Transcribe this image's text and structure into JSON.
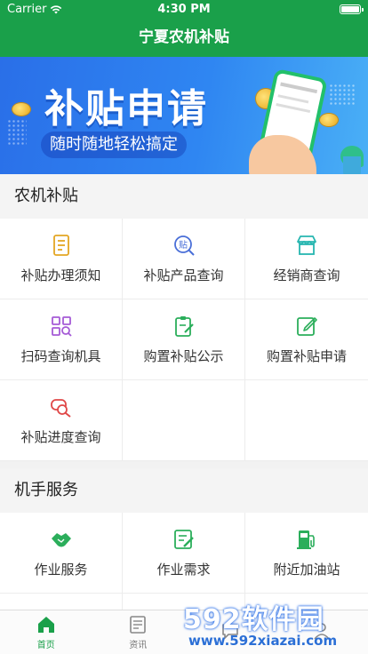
{
  "status": {
    "carrier": "Carrier",
    "time": "4:30 PM"
  },
  "nav": {
    "title": "宁夏农机补贴"
  },
  "banner": {
    "title": "补贴申请",
    "subtitle": "随时随地轻松搞定"
  },
  "sections": {
    "subsidy": {
      "title": "农机补贴",
      "items": [
        {
          "label": "补贴办理须知",
          "icon": "document-list-icon",
          "color": "#e3a623"
        },
        {
          "label": "补贴产品查询",
          "icon": "subsidy-search-icon",
          "color": "#4a6fd8"
        },
        {
          "label": "经销商查询",
          "icon": "storefront-icon",
          "color": "#27b6b0"
        },
        {
          "label": "扫码查询机具",
          "icon": "scan-grid-icon",
          "color": "#a55bd6"
        },
        {
          "label": "购置补贴公示",
          "icon": "clipboard-edit-icon",
          "color": "#2bae5b"
        },
        {
          "label": "购置补贴申请",
          "icon": "form-edit-icon",
          "color": "#2bae5b"
        },
        {
          "label": "补贴进度查询",
          "icon": "progress-search-icon",
          "color": "#e04848"
        }
      ]
    },
    "operator": {
      "title": "机手服务",
      "items": [
        {
          "label": "作业服务",
          "icon": "handshake-icon",
          "color": "#2bae5b"
        },
        {
          "label": "作业需求",
          "icon": "demand-note-icon",
          "color": "#2bae5b"
        },
        {
          "label": "附近加油站",
          "icon": "fuel-pump-icon",
          "color": "#2bae5b"
        }
      ]
    }
  },
  "tabbar": {
    "tabs": [
      {
        "label": "首页",
        "icon": "home-icon",
        "active": true
      },
      {
        "label": "资讯",
        "icon": "news-icon",
        "active": false
      },
      {
        "label": "",
        "icon": "chat-icon",
        "active": false
      },
      {
        "label": "",
        "icon": "profile-icon",
        "active": false
      }
    ]
  },
  "watermark": {
    "brand": "592软件园",
    "url": "www.592xiazai.com"
  },
  "colors": {
    "brand_green": "#1aa04a"
  }
}
